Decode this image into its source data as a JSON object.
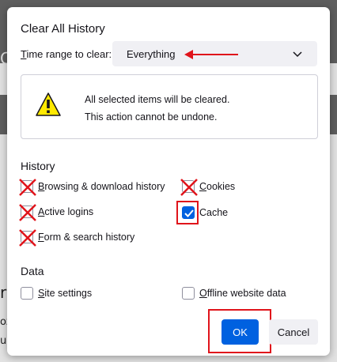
{
  "dialog": {
    "title": "Clear All History",
    "time_range": {
      "label_prefix": "",
      "label_access_key": "T",
      "label_rest": "ime range to clear:",
      "selected": "Everything"
    },
    "warning": {
      "line1": "All selected items will be cleared.",
      "line2": "This action cannot be undone."
    },
    "history_section": {
      "heading": "History",
      "items": [
        {
          "key": "B",
          "rest": "rowsing & download history",
          "checked": false
        },
        {
          "key": "C",
          "rest": "ookies",
          "checked": false
        },
        {
          "key": "A",
          "rest": "ctive logins",
          "checked": false
        },
        {
          "key": "",
          "rest": "Cache",
          "checked": true
        },
        {
          "key": "F",
          "rest": "orm & search history",
          "checked": false
        }
      ]
    },
    "data_section": {
      "heading": "Data",
      "items": [
        {
          "key": "S",
          "rest": "ite settings",
          "checked": false
        },
        {
          "key": "O",
          "rest": "ffline website data",
          "checked": false
        }
      ]
    },
    "buttons": {
      "ok": "OK",
      "cancel": "Cancel"
    }
  },
  "background": {
    "fragments": [
      "C",
      "C",
      "r",
      "oz",
      "ul"
    ]
  },
  "colors": {
    "accent": "#0061e0",
    "annotation_red": "#e0141b",
    "warning_yellow": "#ffe900"
  },
  "icons": [
    "chevron-down-icon",
    "warning-icon",
    "checkmark-icon",
    "cross-mark-icon",
    "arrow-left-icon"
  ]
}
